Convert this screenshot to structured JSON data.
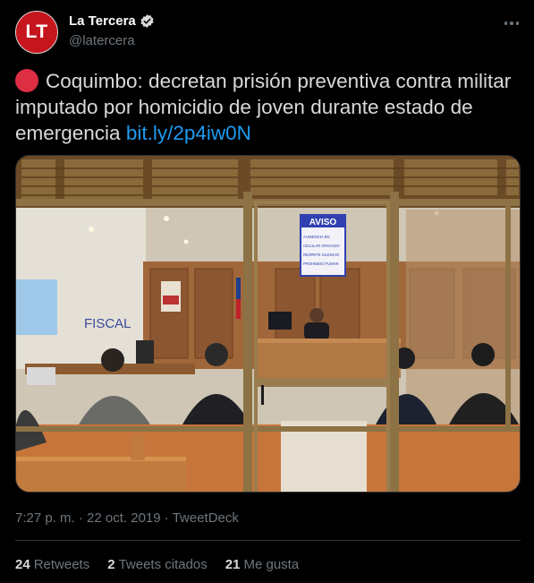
{
  "author": {
    "avatar_initials": "LT",
    "display_name": "La Tercera",
    "handle": "@latercera",
    "verified": true
  },
  "tweet": {
    "emoji": "red-circle",
    "text": "Coquimbo: decretan prisión preventiva contra militar imputado por homicidio de joven durante estado de emergencia",
    "link": "bit.ly/2p4iw0N"
  },
  "photo": {
    "sign_title": "AVISO",
    "sign_lines": [
      "AUDIENCIA EN",
      "CELULAR APAGADO",
      "RESPETE SILENCIO",
      "PROHIBIDO FUMAR"
    ],
    "room_label": "FISCAL"
  },
  "meta": {
    "time": "7:27 p. m.",
    "separator": "·",
    "date": "22 oct. 2019",
    "source": "TweetDeck"
  },
  "stats": [
    {
      "count": "24",
      "label": "Retweets"
    },
    {
      "count": "2",
      "label": "Tweets citados"
    },
    {
      "count": "21",
      "label": "Me gusta"
    }
  ],
  "colors": {
    "background": "#000000",
    "link": "#1d9bf0",
    "secondary_text": "#6e767d",
    "avatar": "#c5161d",
    "verified": "#d9d9d9"
  },
  "icons": [
    "verified-badge-icon",
    "more-options-icon"
  ]
}
